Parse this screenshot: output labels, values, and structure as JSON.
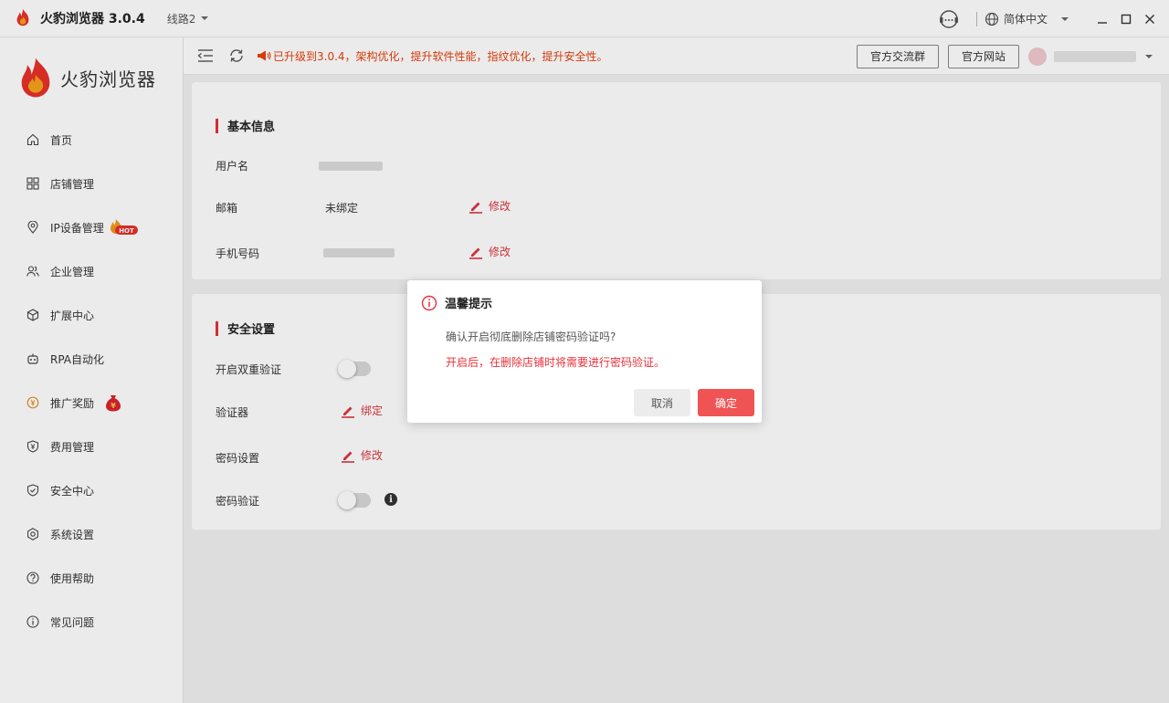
{
  "titlebar": {
    "app_title": "火豹浏览器 3.0.4",
    "route": "线路2",
    "language": "简体中文",
    "icons": {
      "logo": "fire-logo-icon",
      "route_caret": "caret-down-icon",
      "support": "headset-support-icon",
      "language": "globe-icon",
      "language_caret": "caret-down-icon",
      "minimize": "minimize-icon",
      "maximize": "maximize-icon",
      "close": "close-icon"
    }
  },
  "sidebar": {
    "brand": "火豹浏览器",
    "items": [
      {
        "label": "首页",
        "icon": "home-icon"
      },
      {
        "label": "店铺管理",
        "icon": "grid-icon"
      },
      {
        "label": "IP设备管理",
        "icon": "location-pin-icon",
        "badge": "HOT"
      },
      {
        "label": "企业管理",
        "icon": "users-icon"
      },
      {
        "label": "扩展中心",
        "icon": "cube-icon"
      },
      {
        "label": "RPA自动化",
        "icon": "robot-icon"
      },
      {
        "label": "推广奖励",
        "icon": "reward-icon",
        "badge_icon": "money-bag-icon"
      },
      {
        "label": "费用管理",
        "icon": "yen-shield-icon"
      },
      {
        "label": "安全中心",
        "icon": "shield-check-icon"
      },
      {
        "label": "系统设置",
        "icon": "gear-icon"
      },
      {
        "label": "使用帮助",
        "icon": "question-circle-icon"
      },
      {
        "label": "常见问题",
        "icon": "info-circle-icon"
      }
    ]
  },
  "toolbar": {
    "notice": "已升级到3.0.4，架构优化，提升软件性能，指纹优化，提升安全性。",
    "btn_group": "官方交流群",
    "btn_site": "官方网站",
    "icons": {
      "collapse": "menu-collapse-icon",
      "refresh": "refresh-icon",
      "notice": "megaphone-icon",
      "avatar": "user-avatar",
      "user_caret": "caret-down-icon"
    }
  },
  "basic_info": {
    "title": "基本信息",
    "username_label": "用户名",
    "email_label": "邮箱",
    "email_value": "未绑定",
    "email_edit": "修改",
    "phone_label": "手机号码",
    "phone_edit": "修改"
  },
  "security": {
    "title": "安全设置",
    "twofa_label": "开启双重验证",
    "twofa_on": false,
    "authenticator_label": "验证器",
    "authenticator_action": "绑定",
    "password_label": "密码设置",
    "password_action": "修改",
    "pwd_verify_label": "密码验证",
    "pwd_verify_on": false,
    "info_glyph": "i"
  },
  "dialog": {
    "title": "温馨提示",
    "message": "确认开启彻底删除店铺密码验证吗?",
    "warning": "开启后，在删除店铺时将需要进行密码验证。",
    "cancel": "取消",
    "confirm": "确定",
    "icon": "info-circle-icon"
  },
  "colors": {
    "accent_red": "#e8303a",
    "notice_orange": "#e8400c",
    "confirm_button": "#f05353"
  }
}
